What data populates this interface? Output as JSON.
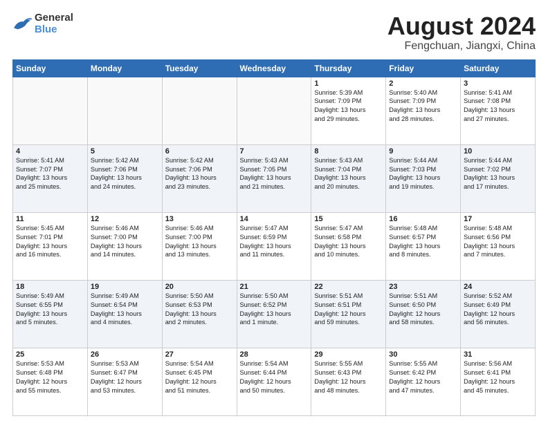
{
  "header": {
    "logo_line1": "General",
    "logo_line2": "Blue",
    "title": "August 2024",
    "subtitle": "Fengchuan, Jiangxi, China"
  },
  "weekdays": [
    "Sunday",
    "Monday",
    "Tuesday",
    "Wednesday",
    "Thursday",
    "Friday",
    "Saturday"
  ],
  "weeks": [
    {
      "shade": false,
      "days": [
        {
          "num": "",
          "info": "",
          "empty": true
        },
        {
          "num": "",
          "info": "",
          "empty": true
        },
        {
          "num": "",
          "info": "",
          "empty": true
        },
        {
          "num": "",
          "info": "",
          "empty": true
        },
        {
          "num": "1",
          "info": "Sunrise: 5:39 AM\nSunset: 7:09 PM\nDaylight: 13 hours\nand 29 minutes.",
          "empty": false
        },
        {
          "num": "2",
          "info": "Sunrise: 5:40 AM\nSunset: 7:09 PM\nDaylight: 13 hours\nand 28 minutes.",
          "empty": false
        },
        {
          "num": "3",
          "info": "Sunrise: 5:41 AM\nSunset: 7:08 PM\nDaylight: 13 hours\nand 27 minutes.",
          "empty": false
        }
      ]
    },
    {
      "shade": true,
      "days": [
        {
          "num": "4",
          "info": "Sunrise: 5:41 AM\nSunset: 7:07 PM\nDaylight: 13 hours\nand 25 minutes.",
          "empty": false
        },
        {
          "num": "5",
          "info": "Sunrise: 5:42 AM\nSunset: 7:06 PM\nDaylight: 13 hours\nand 24 minutes.",
          "empty": false
        },
        {
          "num": "6",
          "info": "Sunrise: 5:42 AM\nSunset: 7:06 PM\nDaylight: 13 hours\nand 23 minutes.",
          "empty": false
        },
        {
          "num": "7",
          "info": "Sunrise: 5:43 AM\nSunset: 7:05 PM\nDaylight: 13 hours\nand 21 minutes.",
          "empty": false
        },
        {
          "num": "8",
          "info": "Sunrise: 5:43 AM\nSunset: 7:04 PM\nDaylight: 13 hours\nand 20 minutes.",
          "empty": false
        },
        {
          "num": "9",
          "info": "Sunrise: 5:44 AM\nSunset: 7:03 PM\nDaylight: 13 hours\nand 19 minutes.",
          "empty": false
        },
        {
          "num": "10",
          "info": "Sunrise: 5:44 AM\nSunset: 7:02 PM\nDaylight: 13 hours\nand 17 minutes.",
          "empty": false
        }
      ]
    },
    {
      "shade": false,
      "days": [
        {
          "num": "11",
          "info": "Sunrise: 5:45 AM\nSunset: 7:01 PM\nDaylight: 13 hours\nand 16 minutes.",
          "empty": false
        },
        {
          "num": "12",
          "info": "Sunrise: 5:46 AM\nSunset: 7:00 PM\nDaylight: 13 hours\nand 14 minutes.",
          "empty": false
        },
        {
          "num": "13",
          "info": "Sunrise: 5:46 AM\nSunset: 7:00 PM\nDaylight: 13 hours\nand 13 minutes.",
          "empty": false
        },
        {
          "num": "14",
          "info": "Sunrise: 5:47 AM\nSunset: 6:59 PM\nDaylight: 13 hours\nand 11 minutes.",
          "empty": false
        },
        {
          "num": "15",
          "info": "Sunrise: 5:47 AM\nSunset: 6:58 PM\nDaylight: 13 hours\nand 10 minutes.",
          "empty": false
        },
        {
          "num": "16",
          "info": "Sunrise: 5:48 AM\nSunset: 6:57 PM\nDaylight: 13 hours\nand 8 minutes.",
          "empty": false
        },
        {
          "num": "17",
          "info": "Sunrise: 5:48 AM\nSunset: 6:56 PM\nDaylight: 13 hours\nand 7 minutes.",
          "empty": false
        }
      ]
    },
    {
      "shade": true,
      "days": [
        {
          "num": "18",
          "info": "Sunrise: 5:49 AM\nSunset: 6:55 PM\nDaylight: 13 hours\nand 5 minutes.",
          "empty": false
        },
        {
          "num": "19",
          "info": "Sunrise: 5:49 AM\nSunset: 6:54 PM\nDaylight: 13 hours\nand 4 minutes.",
          "empty": false
        },
        {
          "num": "20",
          "info": "Sunrise: 5:50 AM\nSunset: 6:53 PM\nDaylight: 13 hours\nand 2 minutes.",
          "empty": false
        },
        {
          "num": "21",
          "info": "Sunrise: 5:50 AM\nSunset: 6:52 PM\nDaylight: 13 hours\nand 1 minute.",
          "empty": false
        },
        {
          "num": "22",
          "info": "Sunrise: 5:51 AM\nSunset: 6:51 PM\nDaylight: 12 hours\nand 59 minutes.",
          "empty": false
        },
        {
          "num": "23",
          "info": "Sunrise: 5:51 AM\nSunset: 6:50 PM\nDaylight: 12 hours\nand 58 minutes.",
          "empty": false
        },
        {
          "num": "24",
          "info": "Sunrise: 5:52 AM\nSunset: 6:49 PM\nDaylight: 12 hours\nand 56 minutes.",
          "empty": false
        }
      ]
    },
    {
      "shade": false,
      "days": [
        {
          "num": "25",
          "info": "Sunrise: 5:53 AM\nSunset: 6:48 PM\nDaylight: 12 hours\nand 55 minutes.",
          "empty": false
        },
        {
          "num": "26",
          "info": "Sunrise: 5:53 AM\nSunset: 6:47 PM\nDaylight: 12 hours\nand 53 minutes.",
          "empty": false
        },
        {
          "num": "27",
          "info": "Sunrise: 5:54 AM\nSunset: 6:45 PM\nDaylight: 12 hours\nand 51 minutes.",
          "empty": false
        },
        {
          "num": "28",
          "info": "Sunrise: 5:54 AM\nSunset: 6:44 PM\nDaylight: 12 hours\nand 50 minutes.",
          "empty": false
        },
        {
          "num": "29",
          "info": "Sunrise: 5:55 AM\nSunset: 6:43 PM\nDaylight: 12 hours\nand 48 minutes.",
          "empty": false
        },
        {
          "num": "30",
          "info": "Sunrise: 5:55 AM\nSunset: 6:42 PM\nDaylight: 12 hours\nand 47 minutes.",
          "empty": false
        },
        {
          "num": "31",
          "info": "Sunrise: 5:56 AM\nSunset: 6:41 PM\nDaylight: 12 hours\nand 45 minutes.",
          "empty": false
        }
      ]
    }
  ]
}
